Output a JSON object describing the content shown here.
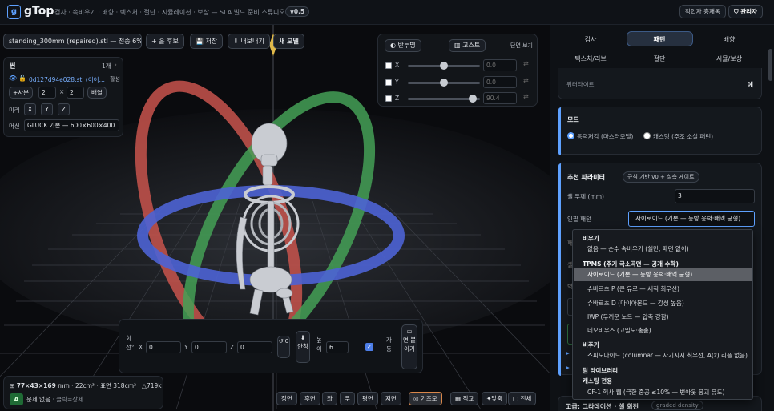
{
  "app": {
    "logo_letter": "g",
    "brand": "gTop",
    "nav": "검사 · 속비우기 · 배향 · 텍스처 · 절단 · 시뮬레이션 · 보상 — SLA 빌드 준비 스튜디오",
    "version": "v0.5",
    "operator_button": "작업자 흉재옥",
    "admin_button": "관리자",
    "accent_color": "#5ea1ff"
  },
  "toolbar": {
    "file_name": "standing_300mm (repaired).stl — 전송 6%…",
    "candidate": "+ 홀 후보",
    "save": "저장",
    "export": "내보내기",
    "new_model": "새 모델"
  },
  "scene": {
    "title": "씬",
    "count": "1개",
    "object_name": "0d127d94e028.stl (이어…",
    "status": "활성",
    "copies_label": "+사본",
    "copies_a": "2",
    "times": "×",
    "copies_b": "2",
    "arrange": "배열",
    "mirror_label": "미러",
    "mirror_x": "X",
    "mirror_y": "Y",
    "mirror_z": "Z",
    "machine_label": "머신",
    "machine_value": "GLUCK 기본 — 600×600×400"
  },
  "section_panel": {
    "translucent": "반투명",
    "ghost": "고스트",
    "section_view": "단면 보기",
    "axes": [
      {
        "name": "X",
        "value": "0.0"
      },
      {
        "name": "Y",
        "value": "0.0"
      },
      {
        "name": "Z",
        "value": "90.4"
      }
    ]
  },
  "transform": {
    "rotate_label": "회전°",
    "x_label": "X",
    "x": "0",
    "y_label": "Y",
    "y": "0",
    "z_label": "Z",
    "z": "0",
    "reset": "↺ 0",
    "seat": "안착",
    "height_label": "높이",
    "height": "6",
    "auto_label": "자동",
    "face_attach": "면 붙이기"
  },
  "stats": {
    "dims": "77×43×169",
    "rest": "mm · 22cm³ · 표면 318cm² · △719k",
    "grade": "A",
    "issue": "문제 없음",
    "detail": "· 클릭=상세"
  },
  "view_buttons": [
    "정면",
    "후면",
    "좌",
    "우",
    "평면",
    "저면"
  ],
  "view_modes": {
    "gyroid": "기즈모",
    "ortho": "직교",
    "fit": "맞춤",
    "all": "전체"
  },
  "sidebar": {
    "tabs_row1": [
      "검사",
      "패턴",
      "배향"
    ],
    "tabs_row2": [
      "텍스처/리브",
      "절단",
      "시뮬/보상"
    ],
    "active_tab": "패턴",
    "peek_label": "위터타이트",
    "peek_value": "예",
    "mode_title": "모드",
    "mode_options": [
      "응력저감 (마스터모델)",
      "캐스팅 (주조 소실 패턴)"
    ],
    "params_title": "추천 파라미터",
    "params_badge": "규칙 기반 v0 + 실측 게이트",
    "shell_label": "쉘 두께 (mm)",
    "shell_value": "3",
    "infill_label": "인필 패턴",
    "infill_value": "자이로이드 (기본 — 등방 응력·배액 균형)",
    "advanced_title": "고급: 그라데이션 · 셀 회전",
    "advanced_badge": "graded density"
  },
  "dropdown": {
    "groups": [
      {
        "label": "비우기",
        "items": [
          "없음 — 순수 속비우기 (쉘만, 패턴 없이)"
        ]
      },
      {
        "label": "TPMS (주기 극소곡면 — 공개 수학)",
        "items": [
          "자이로이드 (기본 — 등방 응력·배액 균형)",
          "슈바르츠 P (큰 유로 — 세척 최우선)",
          "슈바르츠 D (다이아몬드 — 강성 높음)",
          "IWP (두꺼운 노드 — 압축 강함)",
          "네오비우스 (고밀도·촘촘)"
        ]
      },
      {
        "label": "비주기",
        "items": [
          "스피노다이드 (columnar — 자기지지 최우선, A(z) 리플 없음)"
        ]
      },
      {
        "label": "팀 라이브러리",
        "items": []
      },
      {
        "label": "캐스팅 전용",
        "items": [
          "CF-1 혁사 웹 (극한 중공 ≤10% — 번아웃 붕괴 유도)"
        ]
      }
    ],
    "selected": "자이로이드 (기본 — 등방 응력·배액 균형)"
  }
}
